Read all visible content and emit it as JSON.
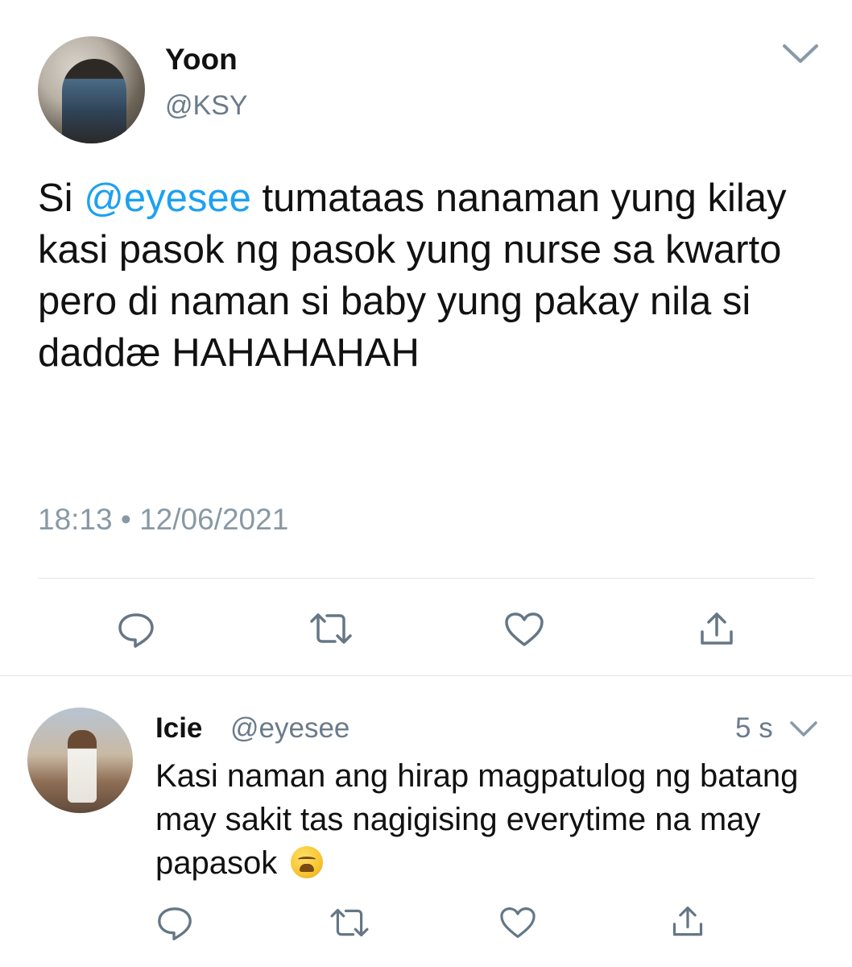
{
  "tweet": {
    "author_name": "Yoon",
    "author_handle": "@KSY",
    "text_prefix": "Si ",
    "mention": "@eyesee",
    "text_body": " tumataas nanaman yung kilay kasi pasok ng pasok yung nurse sa kwarto pero di naman si baby yung pakay nila si daddæ HAHAHAHAH",
    "timestamp": "18:13 • 12/06/2021"
  },
  "reply": {
    "author_name": "Icie",
    "author_handle": "@eyesee",
    "time": "5 s",
    "text": "Kasi naman ang hirap magpatulog ng batang may sakit tas nagigising everytime na may papasok",
    "emoji": "weary-face"
  },
  "icons": {
    "reply": "reply-icon",
    "retweet": "retweet-icon",
    "like": "heart-icon",
    "share": "share-icon",
    "menu": "chevron-down-icon"
  },
  "colors": {
    "mention": "#1da1f2",
    "secondary_text": "#8899a6",
    "icon": "#657786",
    "divider": "#e1e8ed"
  }
}
